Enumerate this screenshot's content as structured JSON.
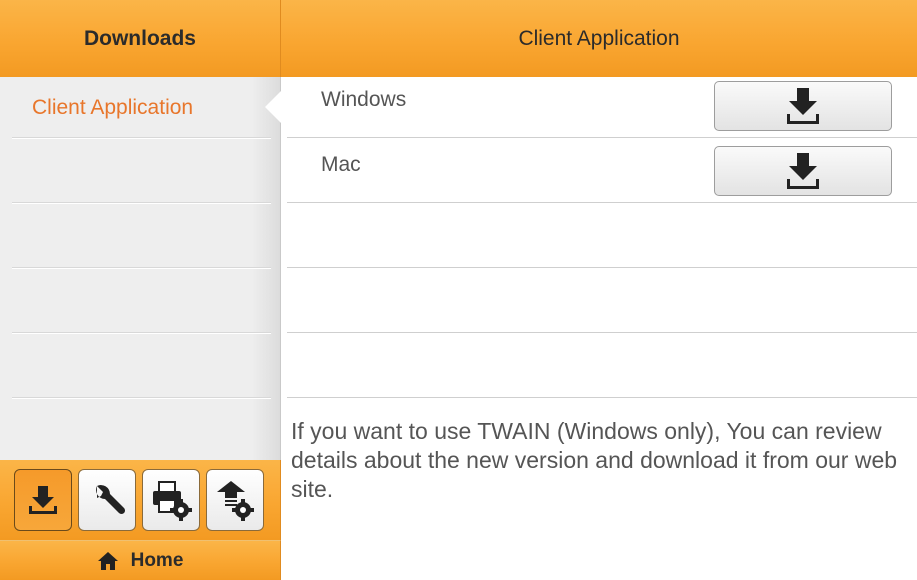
{
  "sidebar": {
    "title": "Downloads",
    "items": [
      {
        "label": "Client Application",
        "selected": true
      }
    ],
    "toolbar": [
      {
        "icon": "download-icon",
        "active": true
      },
      {
        "icon": "wrench-icon",
        "active": false
      },
      {
        "icon": "printer-gear-icon",
        "active": false
      },
      {
        "icon": "upload-gear-icon",
        "active": false
      }
    ],
    "home_label": "Home",
    "home_icon": "home-icon"
  },
  "main": {
    "title": "Client Application",
    "rows": [
      {
        "label": "Windows",
        "button_icon": "download-icon"
      },
      {
        "label": "Mac",
        "button_icon": "download-icon"
      }
    ],
    "note": "If you want to use TWAIN (Windows only), You can review details about the new version and download it from our web site."
  },
  "colors": {
    "header_orange": "#f9a631",
    "selected_text": "#e8762b",
    "sidebar_bg": "#eeeeee"
  }
}
